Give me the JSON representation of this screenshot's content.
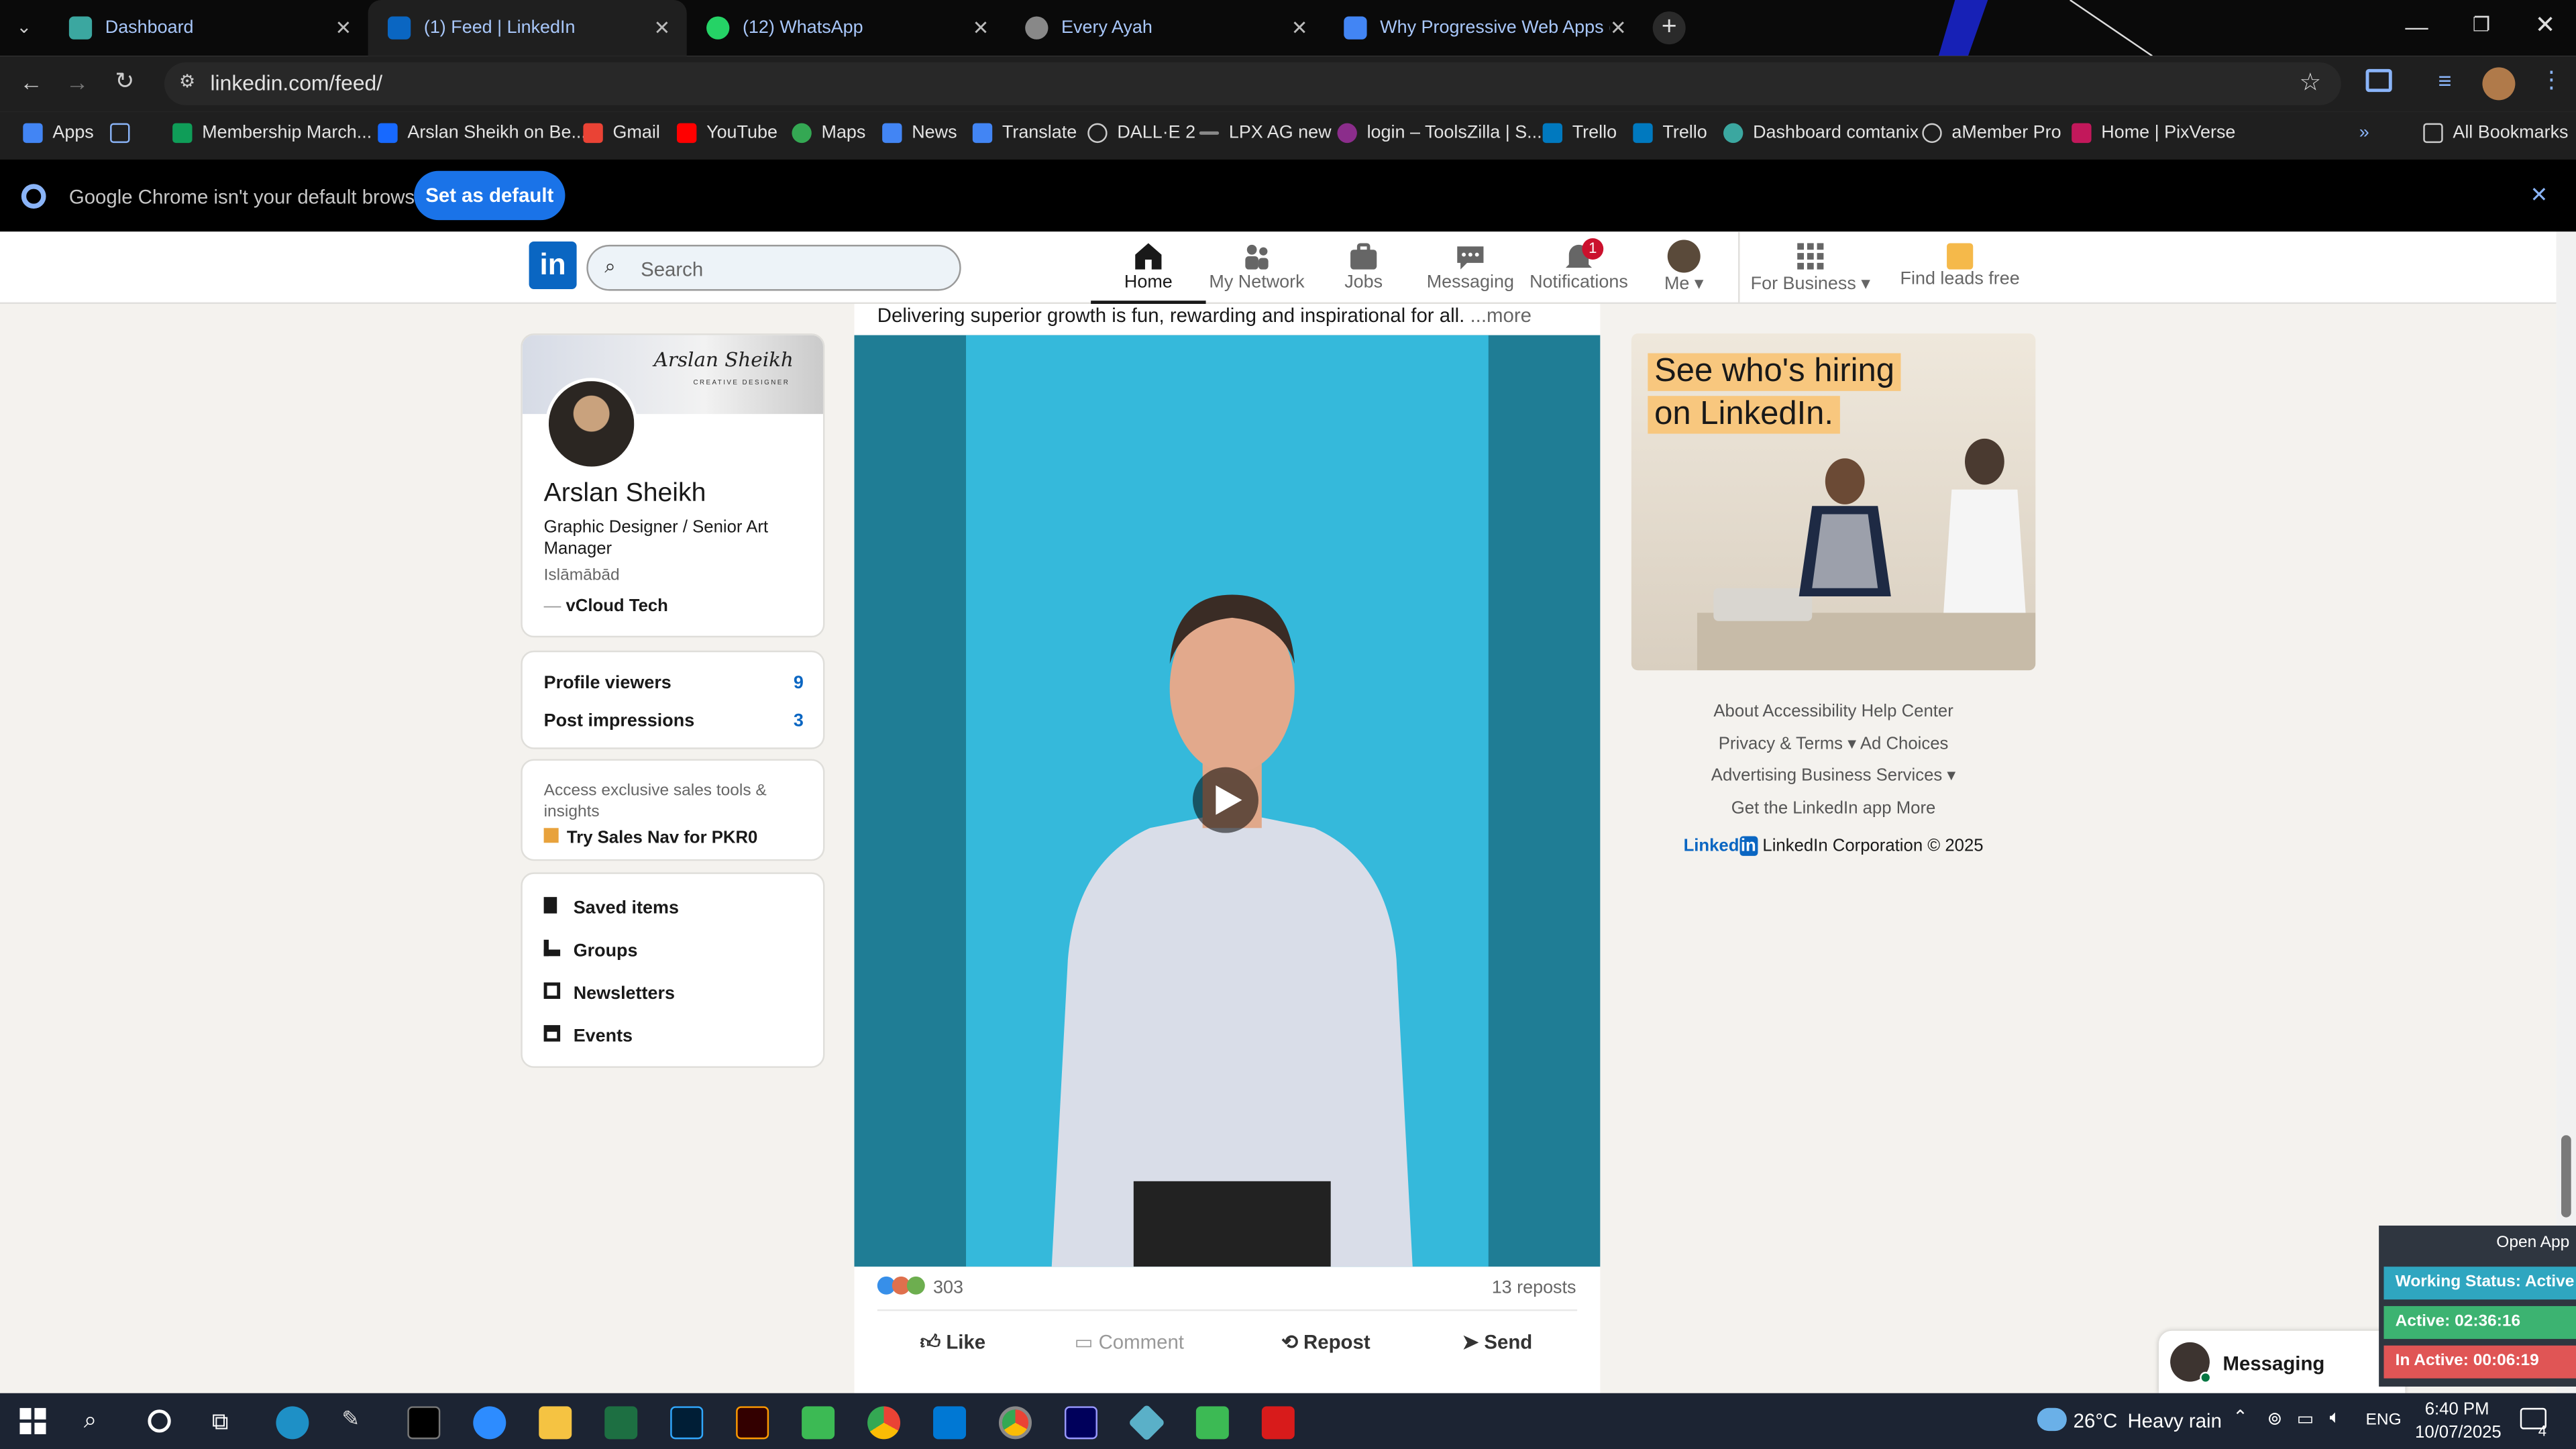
{
  "browser": {
    "tabs": [
      {
        "title": "Dashboard",
        "color": "#3ba7a0"
      },
      {
        "title": "(1) Feed | LinkedIn",
        "color": "#0a66c2"
      },
      {
        "title": "(12) WhatsApp",
        "color": "#25d366"
      },
      {
        "title": "Every Ayah",
        "color": "#888888"
      },
      {
        "title": "Why Progressive Web Apps (PV",
        "color": "#4285f4"
      }
    ],
    "url": "linkedin.com/feed/",
    "bookmarks": [
      "Apps",
      "Membership March...",
      "Arslan Sheikh on Be...",
      "Gmail",
      "YouTube",
      "Maps",
      "News",
      "Translate",
      "DALL·E 2",
      "LPX AG new",
      "login – ToolsZilla | S...",
      "Trello",
      "Trello",
      "Dashboard comtanix",
      "aMember Pro",
      "Home | PixVerse"
    ],
    "all_bookmarks": "All Bookmarks",
    "infobar_text": "Google Chrome isn't your default browser",
    "infobar_button": "Set as default"
  },
  "nav": {
    "search_placeholder": "Search",
    "items": [
      {
        "label": "Home",
        "icon": "home-icon"
      },
      {
        "label": "My Network",
        "icon": "network-icon"
      },
      {
        "label": "Jobs",
        "icon": "briefcase-icon"
      },
      {
        "label": "Messaging",
        "icon": "chat-icon"
      },
      {
        "label": "Notifications",
        "icon": "bell-icon",
        "badge": "1"
      },
      {
        "label": "Me",
        "icon": "avatar-icon"
      }
    ],
    "business": "For Business",
    "leads": "Find leads free"
  },
  "profile": {
    "banner_name": "Arslan Sheikh",
    "banner_sub": "CREATIVE DESIGNER",
    "name": "Arslan Sheikh",
    "headline": "Graphic Designer / Senior Art Manager",
    "location": "Islāmābād",
    "company": "vCloud Tech",
    "stats": [
      {
        "label": "Profile viewers",
        "value": "9"
      },
      {
        "label": "Post impressions",
        "value": "3"
      }
    ],
    "premium_text": "Access exclusive sales tools & insights",
    "premium_link": "Try Sales Nav for PKR0",
    "links": [
      "Saved items",
      "Groups",
      "Newsletters",
      "Events"
    ]
  },
  "post": {
    "text": "Delivering superior growth is fun, rewarding and inspirational for all.",
    "more": "...more",
    "reactions": "303",
    "reposts": "13 reposts",
    "actions": [
      "Like",
      "Comment",
      "Repost",
      "Send"
    ]
  },
  "ad": {
    "line1": "See who's hiring",
    "line2": "on LinkedIn."
  },
  "footer": {
    "row1": [
      "About",
      "Accessibility",
      "Help Center"
    ],
    "row2": [
      "Privacy & Terms",
      "Ad Choices"
    ],
    "row3": [
      "Advertising",
      "Business Services"
    ],
    "row4": [
      "Get the LinkedIn app",
      "More"
    ],
    "brand": "Linked",
    "copyright": "LinkedIn Corporation © 2025"
  },
  "messaging": {
    "label": "Messaging"
  },
  "tracker": {
    "open": "Open App",
    "status": "Working Status: Active",
    "active": "Active: 02:36:16",
    "inactive": "In Active: 00:06:19"
  },
  "taskbar": {
    "weather_temp": "26°C",
    "weather_text": "Heavy rain",
    "lang": "ENG",
    "time": "6:40 PM",
    "date": "10/07/2025",
    "notif_count": "4"
  }
}
